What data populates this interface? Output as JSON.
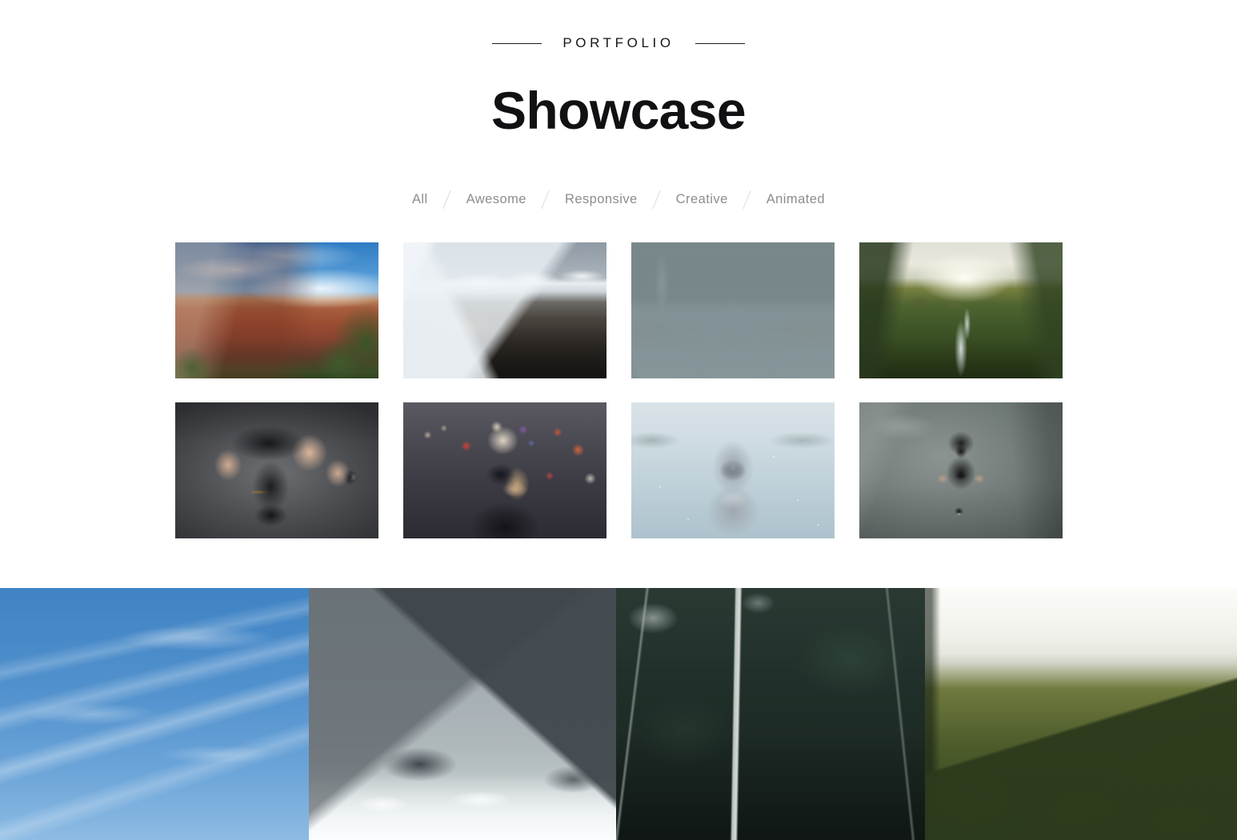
{
  "header": {
    "eyebrow": "PORTFOLIO",
    "title": "Showcase"
  },
  "filters": {
    "items": [
      {
        "label": "All",
        "active": true
      },
      {
        "label": "Awesome",
        "active": false
      },
      {
        "label": "Responsive",
        "active": false
      },
      {
        "label": "Creative",
        "active": false
      },
      {
        "label": "Animated",
        "active": false
      }
    ],
    "separator": "/"
  },
  "gallery": {
    "tiles": [
      {
        "name": "red-canyon-cliffs-under-blue-sky",
        "art": "art-canyon"
      },
      {
        "name": "snow-capped-dark-mountain-range",
        "art": "art-alps-dark"
      },
      {
        "name": "wooden-boardwalk-through-forest",
        "art": "art-boardwalk"
      },
      {
        "name": "green-valley-stream-turf-houses",
        "art": "art-valley"
      },
      {
        "name": "hands-holding-dslr-camera",
        "art": "art-dslr"
      },
      {
        "name": "photographer-on-city-street-at-night",
        "art": "art-street"
      },
      {
        "name": "hooded-photographer-in-snowfall",
        "art": "art-concrete-na-snow"
      },
      {
        "name": "overhead-photographer-on-concrete",
        "art": "art-concrete"
      }
    ]
  },
  "strip": {
    "panels": [
      {
        "name": "blue-sky-with-cirrus-clouds",
        "art": "art-sky"
      },
      {
        "name": "snowy-alpine-peaks",
        "art": "art-peaks"
      },
      {
        "name": "dark-forest-with-birch-trunk",
        "art": "art-forest"
      },
      {
        "name": "green-mountainside-with-turf-houses",
        "art": "art-hillside"
      }
    ]
  },
  "colors": {
    "background": "#ffffff",
    "title": "#111114",
    "eyebrow": "#16161a",
    "filter_text": "#8c8c92",
    "filter_separator": "#dcdce1",
    "rule": "#1b1b1b"
  }
}
